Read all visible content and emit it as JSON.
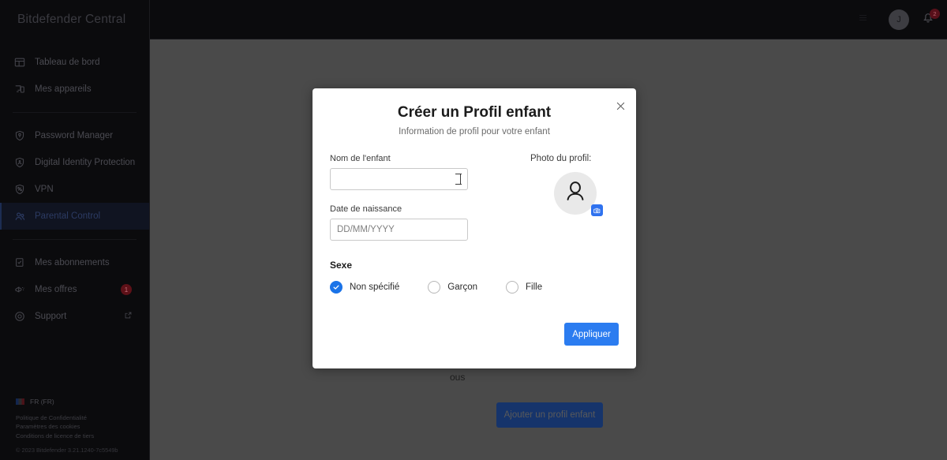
{
  "brand": {
    "title": "Bitdefender Central"
  },
  "sidebar": {
    "groups": [
      {
        "items": [
          {
            "label": "Tableau de bord",
            "icon": "dashboard-icon",
            "active": false
          },
          {
            "label": "Mes appareils",
            "icon": "devices-icon",
            "active": false
          }
        ]
      },
      {
        "items": [
          {
            "label": "Password Manager",
            "icon": "shield-key-icon",
            "active": false
          },
          {
            "label": "Digital Identity Protection",
            "icon": "shield-id-icon",
            "active": false
          },
          {
            "label": "VPN",
            "icon": "shield-vpn-icon",
            "active": false
          },
          {
            "label": "Parental Control",
            "icon": "parental-icon",
            "active": true
          }
        ]
      },
      {
        "items": [
          {
            "label": "Mes abonnements",
            "icon": "subscription-icon",
            "active": false
          },
          {
            "label": "Mes offres",
            "icon": "offers-icon",
            "active": false,
            "badge": "1"
          },
          {
            "label": "Support",
            "icon": "support-icon",
            "active": false,
            "external": true
          }
        ]
      }
    ],
    "footer": {
      "language": "FR (FR)",
      "language_flag": "fr-flag-icon",
      "links": [
        "Politique de Confidentialité",
        "Paramètres des cookies",
        "Conditions de licence de tiers"
      ],
      "copyright": "© 2023 Bitdefender 3.21.1240-7c5549b"
    }
  },
  "topbar": {
    "avatar_initial": "J",
    "notifications_icon": "bell-icon",
    "notifications_count": "2"
  },
  "background": {
    "partial_text": "ous",
    "add_child_button": "Ajouter un profil enfant"
  },
  "modal": {
    "close_icon": "close-icon",
    "title": "Créer un Profil enfant",
    "subtitle": "Information de profil pour votre enfant",
    "name_label": "Nom de l'enfant",
    "name_value": "",
    "name_placeholder": "",
    "birth_label": "Date de naissance",
    "birth_value": "",
    "birth_placeholder": "DD/MM/YYYY",
    "photo_label": "Photo du profil:",
    "photo_avatar_icon": "person-icon",
    "photo_camera_icon": "camera-icon",
    "sex_label": "Sexe",
    "sex_options": [
      {
        "label": "Non spécifié",
        "selected": true
      },
      {
        "label": "Garçon",
        "selected": false
      },
      {
        "label": "Fille",
        "selected": false
      }
    ],
    "apply_label": "Appliquer"
  },
  "colors": {
    "accent_blue": "#2b7cf0",
    "radio_blue": "#1a73e8",
    "backdrop": "#4a4a4a",
    "sidebar_bg": "#0b0b0d",
    "badge_red": "#58101a"
  }
}
